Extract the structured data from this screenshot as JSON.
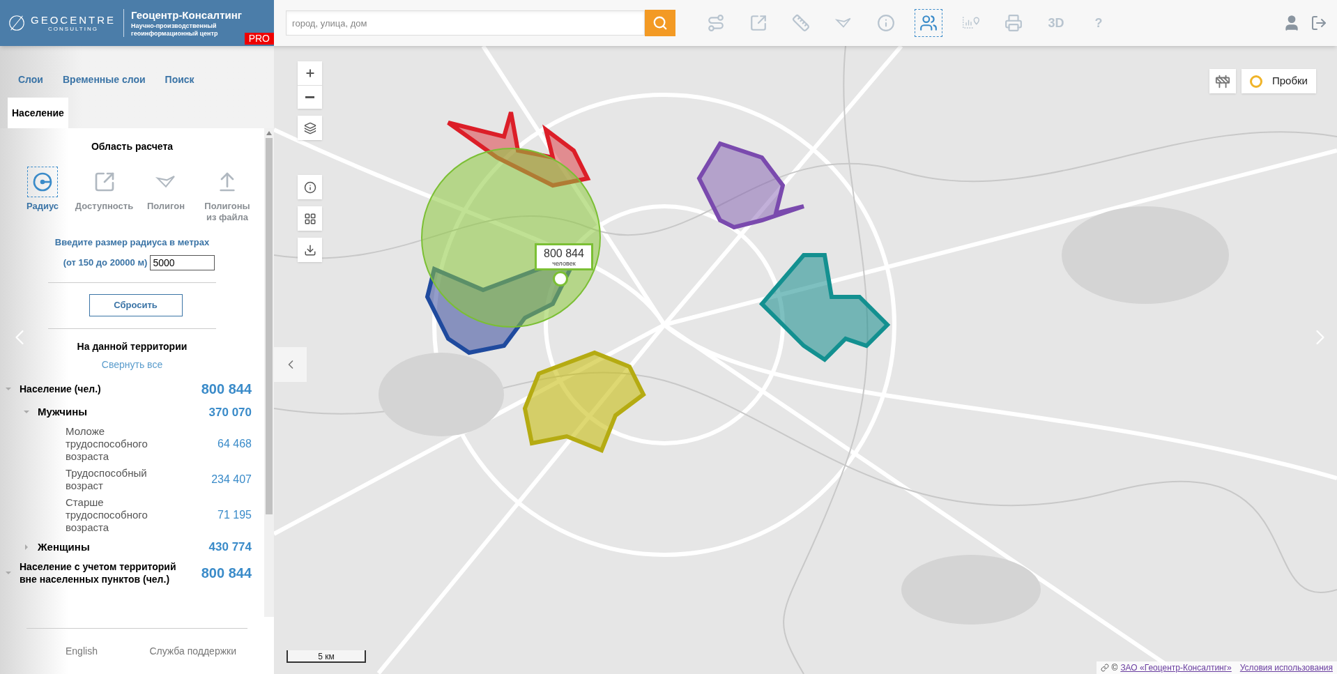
{
  "header": {
    "logo_text": "GEOCENTRE",
    "logo_sub": "CONSULTING",
    "title": "Геоцентр-Консалтинг",
    "subtitle": "Научно-производственный геоинформационный центр",
    "badge": "PRO"
  },
  "search": {
    "placeholder": "город, улица, дом"
  },
  "toolbar": [
    {
      "selected": false
    },
    {
      "selected": false
    },
    {
      "selected": false
    },
    {
      "selected": false
    },
    {
      "selected": false
    },
    {
      "selected": true
    },
    {
      "selected": false
    },
    {
      "selected": false
    },
    {
      "label": "3D",
      "selected": false
    },
    {
      "label": "?",
      "selected": false
    }
  ],
  "nav_links": [
    "Слои",
    "Временные слои",
    "Поиск"
  ],
  "subtabs": [
    {
      "label": "Население",
      "selected": true
    }
  ],
  "area": {
    "title": "Область расчета",
    "modes": [
      {
        "label": "Радиус",
        "selected": true
      },
      {
        "label": "Доступность",
        "selected": false
      },
      {
        "label": "Полигон",
        "selected": false
      },
      {
        "label": "Полигоны из файла",
        "selected": false
      }
    ],
    "prompt": "Введите размер радиуса в метрах",
    "range_label": "(от 150 до 20000 м)",
    "value": "5000",
    "reset_button": "Сбросить"
  },
  "results": {
    "title": "На данной территории",
    "collapse_link": "Свернуть все",
    "tree": [
      {
        "label": "Население (чел.)",
        "value": "800 844",
        "expanded": true,
        "children": [
          {
            "label": "Мужчины",
            "value": "370 070",
            "expanded": true,
            "children": [
              {
                "label": "Моложе трудоспособного возраста",
                "value": "64 468"
              },
              {
                "label": "Трудоспособный возраст",
                "value": "234 407"
              },
              {
                "label": "Старше трудоспособного возраста",
                "value": "71 195"
              }
            ]
          },
          {
            "label": "Женщины",
            "value": "430 774",
            "expanded": false
          }
        ]
      },
      {
        "label": "Население с учетом территорий вне населенных пунктов (чел.)",
        "value": "800 844",
        "expanded": true
      }
    ]
  },
  "footer": [
    "English",
    "Служба поддержки"
  ],
  "map": {
    "popup": {
      "value": "800 844",
      "unit": "человек"
    },
    "traffic_button": "Пробки",
    "scale": "5 км",
    "attribution": {
      "copyright": "©",
      "link": "ЗАО «Геоцентр-Консалтинг»",
      "terms": "Условия использования"
    }
  }
}
